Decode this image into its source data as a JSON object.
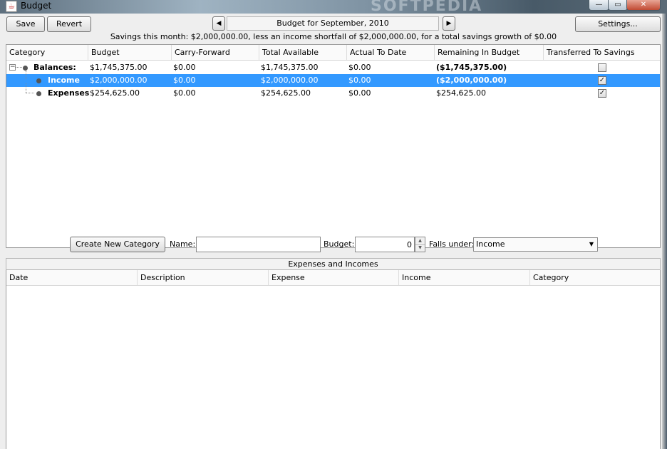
{
  "window": {
    "title": "Budget",
    "watermark": "SOFTPEDIA",
    "icon": "java-cup-icon",
    "controls": {
      "minimize": "—",
      "maximize": "▭",
      "close": "✕"
    }
  },
  "toolbar": {
    "save_label": "Save",
    "revert_label": "Revert",
    "settings_label": "Settings...",
    "prev_label": "◀",
    "next_label": "▶",
    "month_label": "Budget for September, 2010"
  },
  "summary": "Savings this month: $2,000,000.00, less an income shortfall of $2,000,000.00, for a total savings growth of $0.00",
  "category_table": {
    "headers": [
      "Category",
      "Budget",
      "Carry-Forward",
      "Total Available",
      "Actual To Date",
      "Remaining In Budget",
      "Transferred To Savings"
    ],
    "rows": [
      {
        "category": "Balances:",
        "budget": "$1,745,375.00",
        "carry": "$0.00",
        "total": "$1,745,375.00",
        "actual": "$0.00",
        "remaining": "($1,745,375.00)",
        "transferred": false
      },
      {
        "category": "Income",
        "budget": "$2,000,000.00",
        "carry": "$0.00",
        "total": "$2,000,000.00",
        "actual": "$0.00",
        "remaining": "($2,000,000.00)",
        "transferred": true
      },
      {
        "category": "Expenses",
        "budget": "$254,625.00",
        "carry": "$0.00",
        "total": "$254,625.00",
        "actual": "$0.00",
        "remaining": "$254,625.00",
        "transferred": true
      }
    ],
    "selected_row": 1,
    "expander_symbol": "−",
    "checkmark": "✓"
  },
  "new_category": {
    "create_label": "Create New Category",
    "name_label": "Name:",
    "name_value": "",
    "budget_label": "Budget:",
    "budget_value": "0",
    "spin_up": "▲",
    "spin_down": "▼",
    "falls_under_label": "Falls under:",
    "falls_under_value": "Income",
    "dropdown_arrow": "▼"
  },
  "transactions": {
    "title": "Expenses and Incomes",
    "headers": [
      "Date",
      "Description",
      "Expense",
      "Income",
      "Category"
    ],
    "rows": []
  },
  "colors": {
    "selection": "#3399ff",
    "window_bg": "#eeeeee"
  }
}
